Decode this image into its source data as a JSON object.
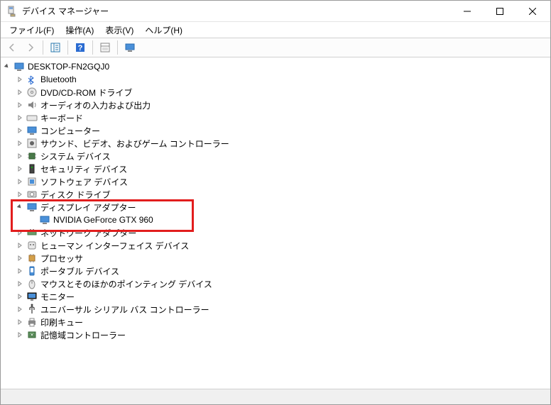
{
  "window": {
    "title": "デバイス マネージャー"
  },
  "menu": {
    "file": "ファイル(F)",
    "action": "操作(A)",
    "view": "表示(V)",
    "help": "ヘルプ(H)"
  },
  "tree": {
    "root": "DESKTOP-FN2GQJ0",
    "bluetooth": "Bluetooth",
    "dvd": "DVD/CD-ROM ドライブ",
    "audio": "オーディオの入力および出力",
    "keyboard": "キーボード",
    "computer": "コンピューター",
    "sound": "サウンド、ビデオ、およびゲーム コントローラー",
    "system": "システム デバイス",
    "security": "セキュリティ デバイス",
    "software": "ソフトウェア デバイス",
    "disk": "ディスク ドライブ",
    "display": "ディスプレイ アダプター",
    "display_child": "NVIDIA GeForce GTX 960",
    "network": "ネットワーク アダプター",
    "hid": "ヒューマン インターフェイス デバイス",
    "processor": "プロセッサ",
    "portable": "ポータブル デバイス",
    "mouse": "マウスとそのほかのポインティング デバイス",
    "monitor": "モニター",
    "usb": "ユニバーサル シリアル バス コントローラー",
    "printq": "印刷キュー",
    "storage": "記憶域コントローラー"
  }
}
